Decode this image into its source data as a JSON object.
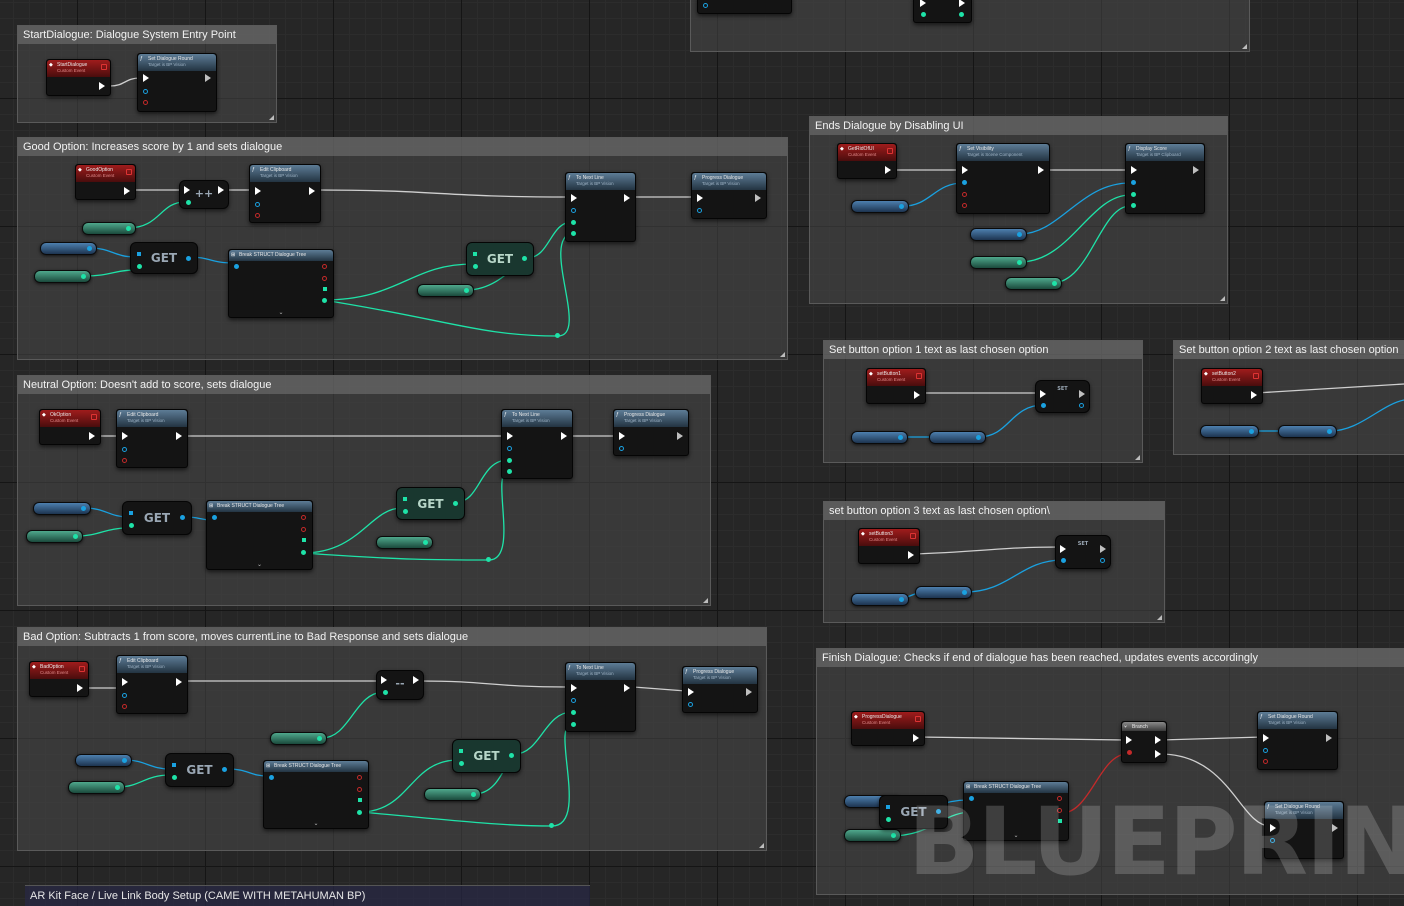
{
  "app": {
    "watermark": "BLUEPRINT"
  },
  "comments": {
    "start": "StartDialogue: Dialogue System Entry Point",
    "good": "Good Option: Increases score by 1 and sets dialogue",
    "neutral": "Neutral Option: Doesn't add to score, sets dialogue",
    "bad": "Bad Option: Subtracts 1 from score, moves currentLine to Bad Response and sets dialogue",
    "ends": "Ends Dialogue by Disabling UI",
    "btn1": "Set button option 1 text as last chosen option",
    "btn2": "Set button option 2 text as last chosen option",
    "btn3": "set button option 3 text as last chosen option\\",
    "finish": "Finish Dialogue: Checks if end of dialogue has been reached, updates events accordingly",
    "arkit": "AR Kit Face / Live Link Body Setup (CAME WITH METAHUMAN BP)"
  },
  "nodes": {
    "start_event": {
      "title": "StartDialogue",
      "sub": "Custom Event"
    },
    "set_round": {
      "title": "Set Dialogue Round",
      "sub": "Target is BP Vision"
    },
    "good_event": {
      "title": "GoodOption",
      "sub": "Custom Event"
    },
    "edit_clipboard": {
      "title": "Edit Clipboard",
      "sub": "Target is BP Vision"
    },
    "to_next_line": {
      "title": "To Next Line",
      "sub": "Target is BP Vision"
    },
    "progress": {
      "title": "Progress Dialogue",
      "sub": "Target is BP Vision"
    },
    "break_struct": {
      "title": "Break STRUCT Dialogue Tree"
    },
    "ok_event": {
      "title": "OkOption",
      "sub": "Custom Event"
    },
    "bad_event": {
      "title": "BadOption",
      "sub": "Custom Event"
    },
    "get_rid_ui": {
      "title": "GetRidOfUI",
      "sub": "Custom Event"
    },
    "set_visibility": {
      "title": "Set Visibility",
      "sub": "Target is Scene Component"
    },
    "display_score": {
      "title": "Display Score",
      "sub": "Target is BP Clipboard"
    },
    "set_button1": {
      "title": "setButton1",
      "sub": "Custom Event"
    },
    "set_button2": {
      "title": "setButton2",
      "sub": "Custom Event"
    },
    "set_button3": {
      "title": "setButton3",
      "sub": "Custom Event"
    },
    "progress_event": {
      "title": "ProgressDialogue",
      "sub": "Custom Event"
    },
    "branch": {
      "title": "Branch"
    },
    "set_round_2": {
      "title": "Set Dialogue Round",
      "sub": "Target is BP Vision"
    }
  },
  "labels": {
    "get": "GET",
    "set": "SET",
    "increment": "++",
    "decrement": "--"
  }
}
